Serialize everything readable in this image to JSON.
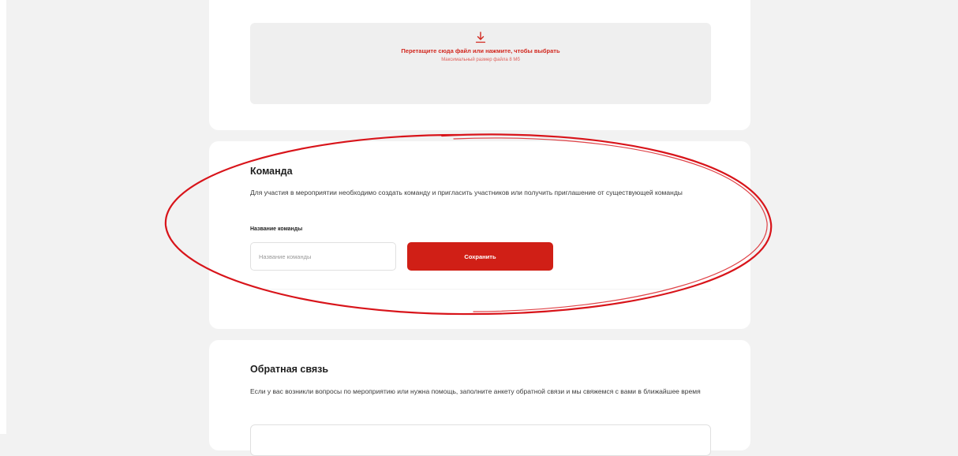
{
  "upload": {
    "title": "Перетащите сюда файл или нажмите, чтобы выбрать",
    "subtitle": "Максимальный размер файла 8 Мб",
    "icon": "download-icon"
  },
  "team": {
    "title": "Команда",
    "description": "Для участия в мероприятии необходимо создать команду и пригласить участников или получить приглашение от существующей команды",
    "field_label": "Название команды",
    "input_placeholder": "Название команды",
    "input_value": "",
    "save_label": "Сохранить"
  },
  "feedback": {
    "title": "Обратная связь",
    "description": "Если у вас возникли вопросы по мероприятию или нужна помощь, заполните анкету обратной связи и мы свяжемся с вами в ближайшее время"
  },
  "colors": {
    "accent": "#d01f16",
    "annotation": "#d8141a",
    "page_background": "#f2f2f2",
    "card_background": "#ffffff",
    "dropzone_background": "#efefef"
  }
}
